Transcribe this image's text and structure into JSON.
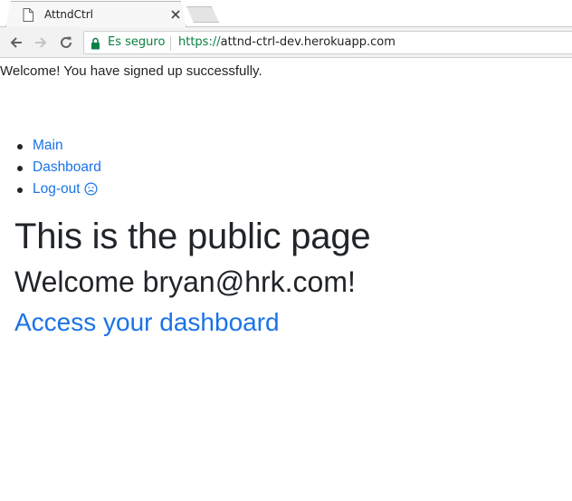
{
  "browser": {
    "tab": {
      "title": "AttndCtrl"
    },
    "omnibox": {
      "security_label": "Es seguro",
      "url_scheme": "https://",
      "url_host": "attnd-ctrl-dev.herokuapp.com"
    }
  },
  "page": {
    "flash_message": "Welcome! You have signed up successfully.",
    "nav": [
      {
        "label": "Main"
      },
      {
        "label": "Dashboard"
      },
      {
        "label": "Log-out",
        "icon": "sad-face-icon"
      }
    ],
    "heading": "This is the public page",
    "welcome": "Welcome bryan@hrk.com!",
    "dashboard_link": "Access your dashboard"
  },
  "colors": {
    "link": "#1a73e8",
    "secure": "#0b8043",
    "text": "#212529"
  }
}
